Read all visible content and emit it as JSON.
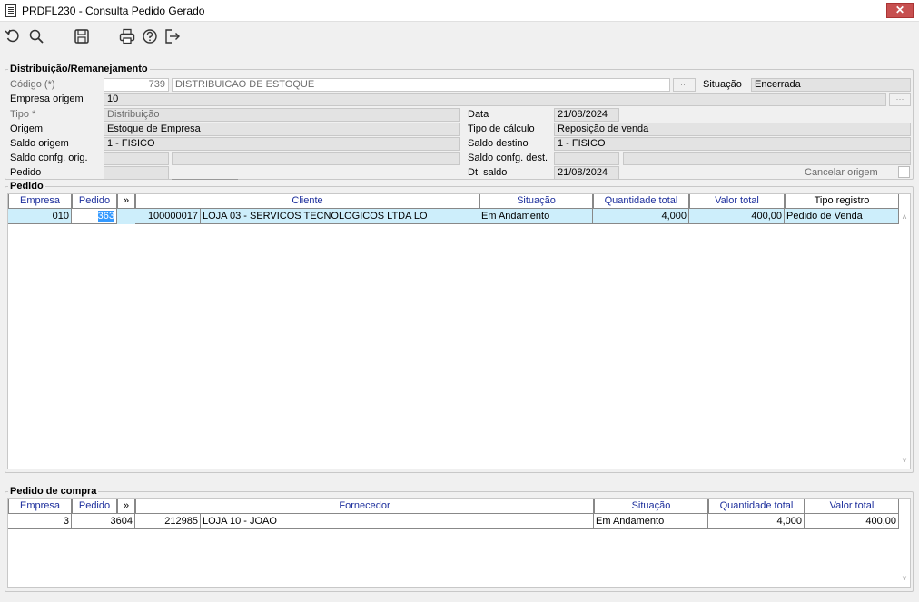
{
  "window": {
    "title": "PRDFL230 - Consulta Pedido Gerado",
    "close_glyph": "✕"
  },
  "toolbar": {
    "icons": [
      "undo-icon",
      "search-icon",
      "save-icon",
      "print-icon",
      "help-icon",
      "exit-icon"
    ]
  },
  "distribuicao": {
    "group_label": "Distribuição/Remanejamento",
    "codigo_label": "Código (*)",
    "codigo_value": "739",
    "codigo_desc": "DISTRIBUICAO DE ESTOQUE",
    "situacao_label": "Situação",
    "situacao_value": "Encerrada",
    "empresa_origem_label": "Empresa origem",
    "empresa_origem_value": "10",
    "tipo_label": "Tipo *",
    "tipo_value": "Distribuição",
    "data_label": "Data",
    "data_value": "21/08/2024",
    "origem_label": "Origem",
    "origem_value": "Estoque de Empresa",
    "tipo_calculo_label": "Tipo de cálculo",
    "tipo_calculo_value": "Reposição de venda",
    "saldo_origem_label": "Saldo origem",
    "saldo_origem_value": "1 - FISICO",
    "saldo_destino_label": "Saldo destino",
    "saldo_destino_value": "1 - FISICO",
    "saldo_confg_orig_label": "Saldo confg. orig.",
    "saldo_confg_dest_label": "Saldo confg. dest.",
    "pedido_label": "Pedido",
    "dt_saldo_label": "Dt. saldo",
    "dt_saldo_value": "21/08/2024",
    "cancelar_origem_label": "Cancelar origem"
  },
  "pedido_grid": {
    "group_label": "Pedido",
    "columns": [
      "Empresa",
      "Pedido",
      "»",
      "Cliente",
      "Situação",
      "Quantidade total",
      "Valor total",
      "Tipo registro"
    ],
    "rows": [
      {
        "empresa": "010",
        "pedido": "363",
        "cliente_cod": "100000017",
        "cliente": "LOJA 03 - SERVICOS TECNOLOGICOS LTDA   LO",
        "situacao": "Em Andamento",
        "quantidade": "4,000",
        "valor": "400,00",
        "tipo_registro": "Pedido de Venda"
      }
    ]
  },
  "compra_grid": {
    "group_label": "Pedido de compra",
    "columns": [
      "Empresa",
      "Pedido",
      "»",
      "Fornecedor",
      "Situação",
      "Quantidade total",
      "Valor total"
    ],
    "rows": [
      {
        "empresa": "3",
        "pedido": "3604",
        "fornecedor_cod": "212985",
        "fornecedor": "LOJA 10 - JOAO",
        "situacao": "Em Andamento",
        "quantidade": "4,000",
        "valor": "400,00"
      }
    ]
  },
  "colors": {
    "selected_row": "#cdeefb",
    "header_text": "#1c2e9c",
    "close_button": "#c75050"
  }
}
